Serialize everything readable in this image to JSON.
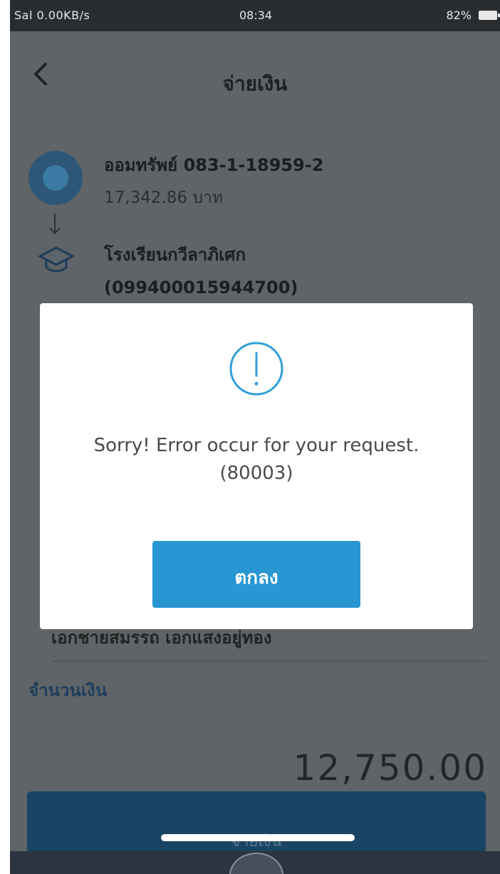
{
  "status_bar": {
    "left": "Sal 0.00KB/s",
    "time": "08:34",
    "battery": "82%"
  },
  "header": {
    "title": "จ่ายเงิน"
  },
  "transfer": {
    "from_account": "ออมทรัพย์ 083-1-18959-2",
    "from_balance": "17,342.86 บาท",
    "to_name": "โรงเรียนกวีลาภิเศก",
    "to_id": "(099400015944700)"
  },
  "reference": {
    "text": "เอกชายสมรรถ เอกแสงอยู่ทอง"
  },
  "amount": {
    "label": "จำนวนเงิน",
    "value": "12,750.00"
  },
  "confirm_button": {
    "label": "จ่ายเงิน"
  },
  "dialog": {
    "message": "Sorry! Error occur for your request.",
    "code": "(80003)",
    "ok_label": "ตกลง"
  },
  "colors": {
    "overlay": "#5e6467",
    "dialog_button": "#2896d3",
    "icon_accent": "#2fa0d8"
  }
}
